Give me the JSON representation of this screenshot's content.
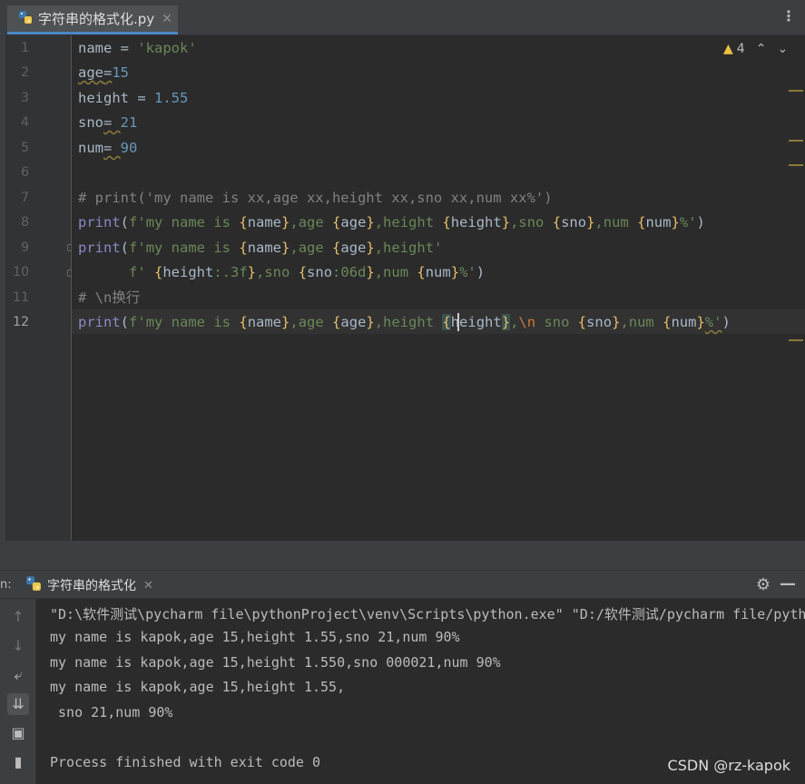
{
  "editor_tab": {
    "label": "字符串的格式化.py",
    "icon": "python-icon",
    "close": "✕"
  },
  "tab_menu": "⋮",
  "inspection": {
    "warnings": "4",
    "icon": "warning-triangle-icon"
  },
  "line_numbers": [
    "1",
    "2",
    "3",
    "4",
    "5",
    "6",
    "7",
    "8",
    "9",
    "10",
    "11",
    "12"
  ],
  "code": {
    "l1": {
      "a": "name = ",
      "b": "'kapok'"
    },
    "l2": {
      "a": "age",
      "b": "=",
      "c": "15"
    },
    "l3": {
      "a": "height = ",
      "b": "1.55"
    },
    "l4": {
      "a": "sno",
      "b": "= ",
      "c": "21"
    },
    "l5": {
      "a": "num",
      "b": "= ",
      "c": "90"
    },
    "l7": "# print('my name is xx,age xx,height xx,sno xx,num xx%')",
    "l8": {
      "fn": "print",
      "open": "(",
      "pre": "f'",
      "t1": "my name is ",
      "o1": "{",
      "v1": "name",
      "c1": "}",
      "t2": ",age ",
      "o2": "{",
      "v2": "age",
      "c2": "}",
      "t3": ",height ",
      "o3": "{",
      "v3": "height",
      "c3": "}",
      "t4": ",sno ",
      "o4": "{",
      "v4": "sno",
      "c4": "}",
      "t5": ",num ",
      "o5": "{",
      "v5": "num",
      "c5": "}",
      "t6": "%'",
      "close": ")"
    },
    "l9": {
      "fn": "print",
      "open": "(",
      "pre": "f'",
      "t1": "my name is ",
      "o1": "{",
      "v1": "name",
      "c1": "}",
      "t2": ",age ",
      "o2": "{",
      "v2": "age",
      "c2": "}",
      "t3": ",height'"
    },
    "l10": {
      "indent": "      ",
      "pre": "f' ",
      "o1": "{",
      "v1": "height",
      "f1": ":.3f",
      "c1": "}",
      "t2": ",sno ",
      "o2": "{",
      "v2": "sno",
      "f2": ":06d",
      "c2": "}",
      "t3": ",num ",
      "o3": "{",
      "v3": "num",
      "c3": "}",
      "t4": "%'",
      "close": ")"
    },
    "l11": "# \\n换行",
    "l12": {
      "fn": "print",
      "open": "(",
      "pre": "f'",
      "t1": "my name is ",
      "o1": "{",
      "v1": "name",
      "c1": "}",
      "t2": ",age ",
      "o2": "{",
      "v2": "age",
      "c2": "}",
      "t3": ",height ",
      "o3": "{",
      "v3": "height",
      "c3": "}",
      "t4": ",",
      "esc": "\\n",
      "t5": " sno ",
      "o4": "{",
      "v4": "sno",
      "c4": "}",
      "t6": ",num ",
      "o5": "{",
      "v5": "num",
      "c5": "}",
      "t7": "%'",
      "close": ")"
    }
  },
  "run": {
    "prefix": "n:",
    "tab_label": "字符串的格式化",
    "close": "✕"
  },
  "console": [
    "\"D:\\软件测试\\pycharm file\\pythonProject\\venv\\Scripts\\python.exe\" \"D:/软件测试/pycharm file/pythonProject/字符串的格式化.py\"",
    "my name is kapok,age 15,height 1.55,sno 21,num 90%",
    "my name is kapok,age 15,height 1.550,sno 000021,num 90%",
    "my name is kapok,age 15,height 1.55,",
    " sno 21,num 90%",
    "",
    "Process finished with exit code 0"
  ],
  "watermark": "CSDN @rz-kapok",
  "colors": {
    "keyword": "#cc7832",
    "string": "#6a8759",
    "number": "#6897bb",
    "comment": "#808080",
    "accent": "#4a88c7"
  }
}
